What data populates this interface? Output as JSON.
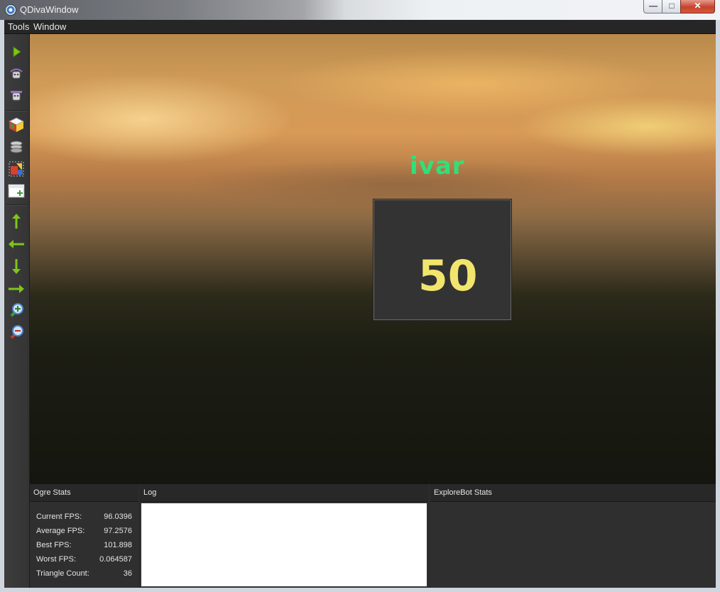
{
  "window": {
    "title": "QDivaWindow"
  },
  "title_buttons": {
    "minimize": "—",
    "maximize": "□",
    "close": "✕"
  },
  "menu": {
    "items": [
      "Tools",
      "Window"
    ]
  },
  "toolbar": {
    "groups": [
      [
        "play-icon",
        "robot-refresh-icon",
        "robot-icon"
      ],
      [
        "color-cube-icon",
        "stack-icon",
        "shapes-image-icon",
        "add-panel-icon"
      ],
      [
        "arrow-up-icon",
        "arrow-left-icon",
        "arrow-down-icon",
        "arrow-right-icon",
        "zoom-in-icon",
        "zoom-out-icon"
      ]
    ],
    "accent": "#7fc51a"
  },
  "viewport": {
    "bot_name": "ivar",
    "bot_value": "50",
    "bot_name_color": "#2fe07a",
    "bot_value_color": "#f2e56d"
  },
  "ogre_stats": {
    "title": "Ogre Stats",
    "rows": [
      {
        "label": "Current FPS:",
        "value": "96.0396"
      },
      {
        "label": "Average FPS:",
        "value": "97.2576"
      },
      {
        "label": "Best FPS:",
        "value": "101.898"
      },
      {
        "label": "Worst FPS:",
        "value": "0.064587"
      },
      {
        "label": "Triangle Count:",
        "value": "36"
      }
    ]
  },
  "log": {
    "title": "Log",
    "content": ""
  },
  "explorebot_stats": {
    "title": "ExploreBot Stats"
  }
}
